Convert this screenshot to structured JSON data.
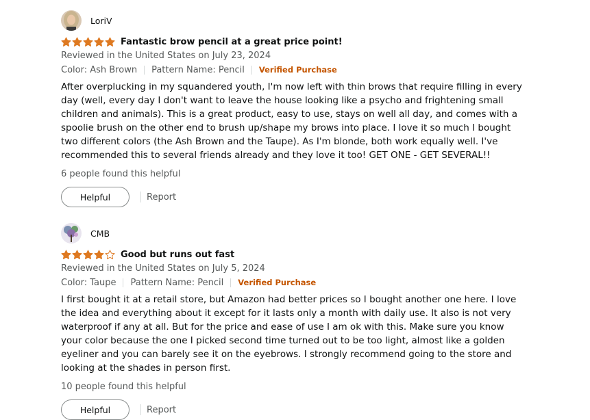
{
  "reviews": [
    {
      "profile_name": "LoriV",
      "rating": 5,
      "title": "Fantastic brow pencil at a great price point!",
      "reviewed_line": "Reviewed in the United States on July 23, 2024",
      "color": "Color: Ash Brown",
      "pattern": "Pattern Name: Pencil",
      "verified": "Verified Purchase",
      "body": "After overplucking in my squandered youth, I'm now left with thin brows that require filling in every day (well, every day I don't want to leave the house looking like a psycho and frightening small children and animals). This is a great product, easy to use, stays on well all day, and comes with a spoolie brush on the other end to brush up/shape my brows into place. I love it so much I bought two different colors (the Ash Brown and the Taupe). As I'm blonde, both work equally well. I've recommended this to several friends already and they love it too! GET ONE - GET SEVERAL!!",
      "helpful_count": "6 people found this helpful",
      "helpful_label": "Helpful",
      "report_label": "Report"
    },
    {
      "profile_name": "CMB",
      "rating": 4,
      "title": "Good but runs out fast",
      "reviewed_line": "Reviewed in the United States on July 5, 2024",
      "color": "Color: Taupe",
      "pattern": "Pattern Name: Pencil",
      "verified": "Verified Purchase",
      "body": "I first bought it at a retail store, but Amazon had better prices so I bought another one here. I love the idea and everything about it except for it lasts only a month with daily use. It also is not very waterproof if any at all. But for the price and ease of use I am ok with this. Make sure you know your color because the one I picked second time turned out to be too light, almost like a golden eyeliner and you can barely see it on the eyebrows. I strongly recommend going to the store and looking at the shades in person first.",
      "helpful_count": "10 people found this helpful",
      "helpful_label": "Helpful",
      "report_label": "Report"
    }
  ],
  "colors": {
    "star_fill": "#de7921",
    "verified": "#c45500",
    "meta_text": "#565959"
  }
}
